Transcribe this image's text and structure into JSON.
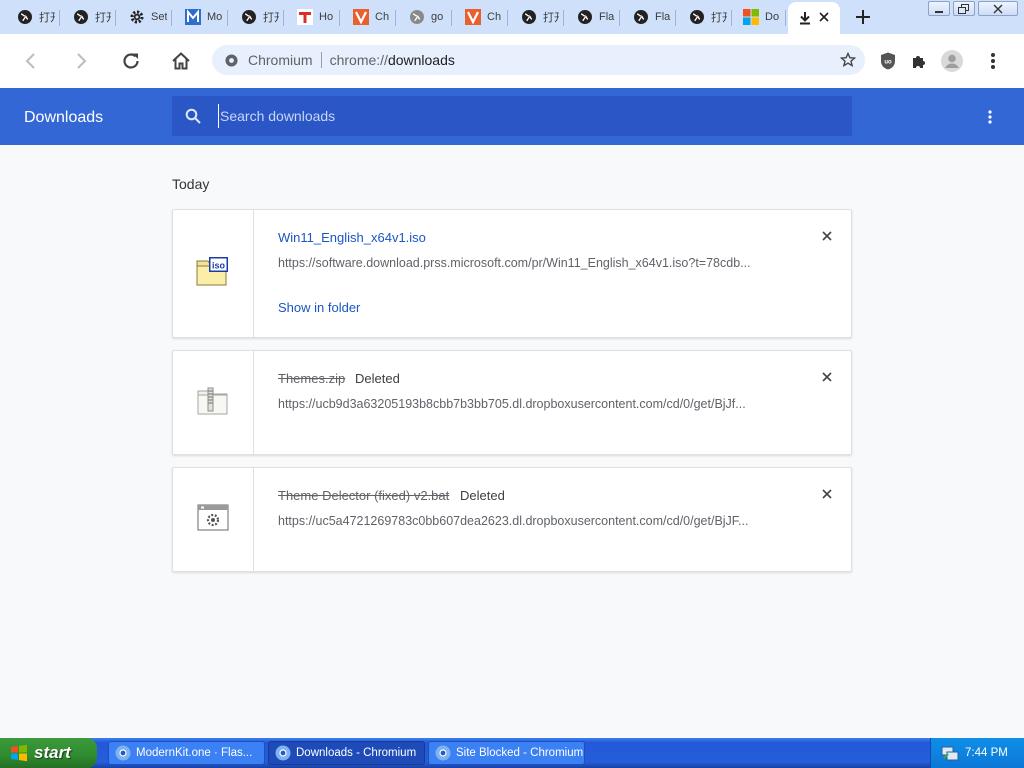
{
  "tabs": [
    {
      "label": "打开",
      "icon": "globe-icon"
    },
    {
      "label": "打开",
      "icon": "globe-icon"
    },
    {
      "label": "Set",
      "icon": "gear-icon"
    },
    {
      "label": "Mo",
      "icon": "modernkit-m-icon"
    },
    {
      "label": "打开",
      "icon": "globe-icon"
    },
    {
      "label": "Ho",
      "icon": "t-logo-icon"
    },
    {
      "label": "Ch",
      "icon": "v-logo-icon"
    },
    {
      "label": "go",
      "icon": "gray-globe-icon"
    },
    {
      "label": "Ch",
      "icon": "v-logo-icon"
    },
    {
      "label": "打开",
      "icon": "globe-icon"
    },
    {
      "label": "Fla",
      "icon": "globe-icon"
    },
    {
      "label": "Fla",
      "icon": "globe-icon"
    },
    {
      "label": "打开",
      "icon": "globe-icon"
    },
    {
      "label": "Do",
      "icon": "microsoft-logo-icon"
    }
  ],
  "omnibox": {
    "site_name": "Chromium",
    "url_scheme": "chrome://",
    "url_host": "downloads"
  },
  "downloads": {
    "title": "Downloads",
    "search_placeholder": "Search downloads",
    "section_date": "Today",
    "items": [
      {
        "filename": "Win11_English_x64v1.iso",
        "url": "https://software.download.prss.microsoft.com/pr/Win11_English_x64v1.iso?t=78cdb...",
        "status": "",
        "action": "Show in folder",
        "deleted": false,
        "icon": "iso-file-icon"
      },
      {
        "filename": "Themes.zip",
        "url": "https://ucb9d3a63205193b8cbb7b3bb705.dl.dropboxusercontent.com/cd/0/get/BjJf...",
        "status": "Deleted",
        "deleted": true,
        "icon": "zip-file-icon"
      },
      {
        "filename": "Theme Delector (fixed) v2.bat",
        "url": "https://uc5a4721269783c0bb607dea2623.dl.dropboxusercontent.com/cd/0/get/BjJF...",
        "status": "Deleted",
        "deleted": true,
        "icon": "batch-file-icon"
      }
    ]
  },
  "taskbar": {
    "start_label": "start",
    "tasks": [
      {
        "label": "ModernKit.one · Flas..."
      },
      {
        "label": "Downloads - Chromium"
      },
      {
        "label": "Site Blocked - Chromium"
      }
    ],
    "clock": "7:44 PM"
  }
}
